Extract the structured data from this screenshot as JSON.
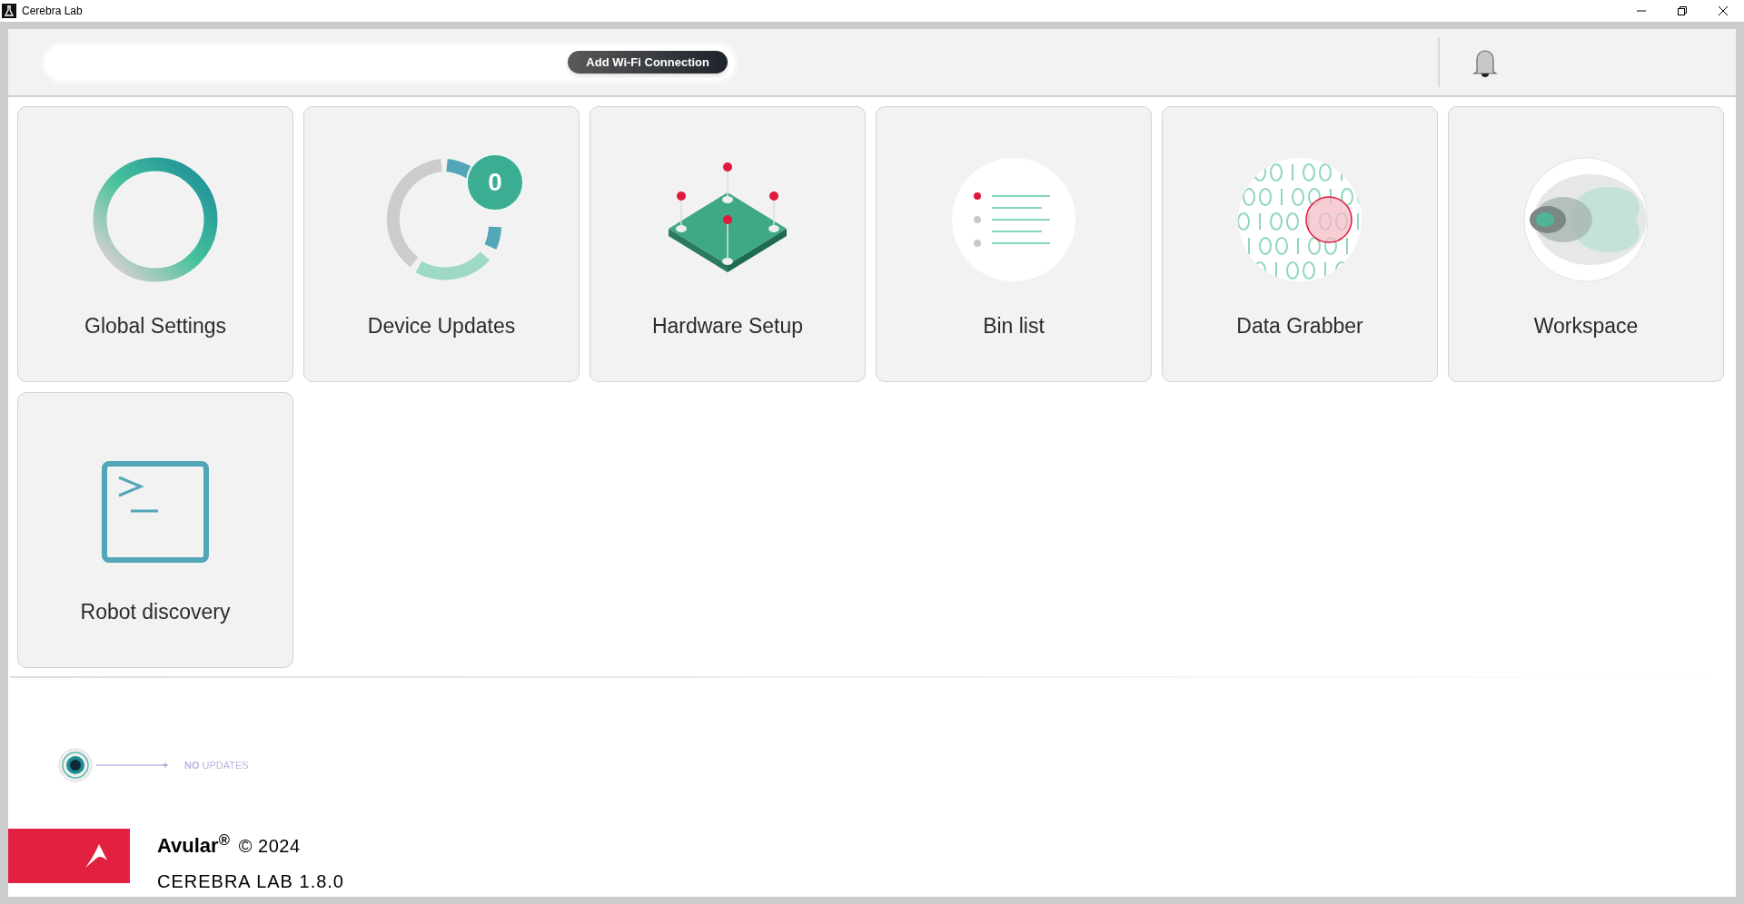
{
  "window": {
    "title": "Cerebra Lab"
  },
  "header": {
    "wifi_button": "Add Wi-Fi Connection"
  },
  "tiles": [
    {
      "label": "Global Settings",
      "kind": "ring"
    },
    {
      "label": "Device Updates",
      "kind": "cycle",
      "badge": "0"
    },
    {
      "label": "Hardware Setup",
      "kind": "board"
    },
    {
      "label": "Bin list",
      "kind": "list"
    },
    {
      "label": "Data Grabber",
      "kind": "binary"
    },
    {
      "label": "Workspace",
      "kind": "blobs"
    },
    {
      "label": "Robot discovery",
      "kind": "terminal"
    }
  ],
  "update_status": "**NO** UPDATES",
  "footer": {
    "brand": "Avular$^{®}$",
    "copyright": "© 2024",
    "version": "CEREBRA LAB 1.8.0"
  }
}
